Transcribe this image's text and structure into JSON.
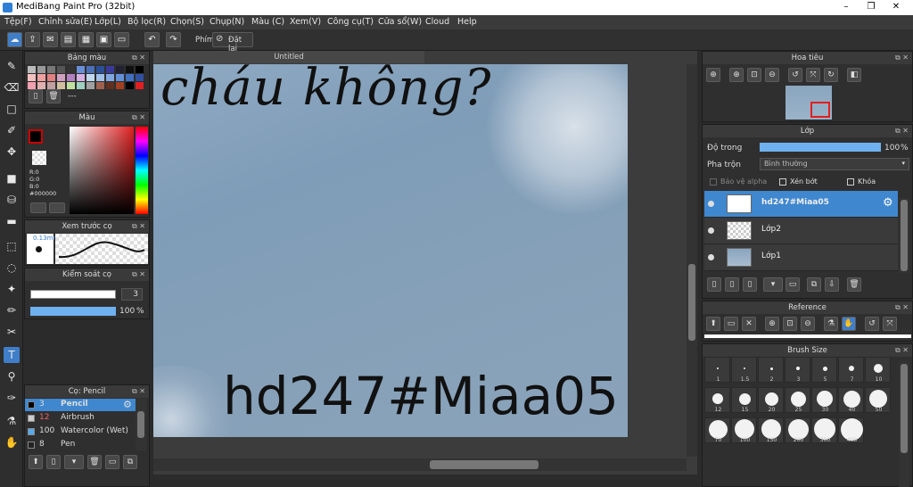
{
  "window": {
    "title": "MediBang Paint Pro (32bit)",
    "minimize": "–",
    "restore": "❒",
    "close": "✕"
  },
  "menu": [
    "Tệp(F)",
    "Chỉnh sửa(E)",
    "Lớp(L)",
    "Bộ lọc(R)",
    "Chọn(S)",
    "Chụp(N)",
    "Màu (C)",
    "Xem(V)",
    "Công cụ(T)",
    "Cửa sổ(W)",
    "Cloud",
    "Help"
  ],
  "toolbar": {
    "phim_label": "Phím",
    "reset_label": "Đặt lại"
  },
  "color_palette": {
    "title": "Bảng màu",
    "dash_text": "---"
  },
  "color_panel": {
    "title": "Màu",
    "r": "R:0",
    "g": "G:0",
    "b": "B:0",
    "hex": "#000000"
  },
  "brush_preview": {
    "title": "Xem trước cọ",
    "size": "0.13mm"
  },
  "brush_control": {
    "title": "Kiểm soát cọ",
    "size_value": "3",
    "opacity_value": "100",
    "opacity_unit": "%",
    "opacity_level": 1.0
  },
  "brush_list": {
    "title": "Cọ: Pencil",
    "items": [
      {
        "size": "3",
        "name": "Pencil",
        "color": "#000000",
        "selected": true
      },
      {
        "size": "12",
        "name": "Airbrush",
        "color": "#cccccc",
        "selected": false
      },
      {
        "size": "100",
        "name": "Watercolor (Wet)",
        "color": "#55aaee",
        "selected": false
      },
      {
        "size": "8",
        "name": "Pen",
        "color": "#222222",
        "selected": false
      }
    ]
  },
  "canvas": {
    "tab_title": "Untitled",
    "handwriting": "cháu không?",
    "stamp": "hd247#Miaa05"
  },
  "navigator": {
    "title": "Hoa tiêu"
  },
  "layer_panel": {
    "title": "Lớp",
    "opacity_label": "Độ trong",
    "opacity_value": "100",
    "opacity_unit": "%",
    "opacity_level": 1.0,
    "blend_label": "Pha trộn",
    "blend_value": "Bình thường",
    "protect_alpha": "Bảo vệ alpha",
    "clipping": "Xén bớt",
    "lock": "Khóa",
    "layers": [
      {
        "name": "hd247#Miaa05",
        "selected": true
      },
      {
        "name": "Lớp2",
        "selected": false
      },
      {
        "name": "Lớp1",
        "selected": false
      }
    ]
  },
  "reference": {
    "title": "Reference"
  },
  "brush_size": {
    "title": "Brush Size",
    "sizes": [
      "1",
      "1.5",
      "2",
      "3",
      "5",
      "7",
      "10",
      "12",
      "15",
      "20",
      "25",
      "30",
      "40",
      "50",
      "70",
      "100",
      "150",
      "200",
      "300",
      "400"
    ]
  },
  "colors": {
    "accent": "#3f7ec8",
    "panel": "#2f2f2f",
    "selected_row": "#3f87cf"
  }
}
